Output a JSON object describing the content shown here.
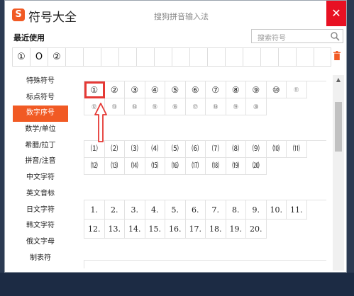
{
  "window": {
    "app_title": "符号大全",
    "logo": "S",
    "ime_name": "搜狗拼音输入法",
    "close": "✕"
  },
  "recent": {
    "label": "最近使用",
    "items": [
      "①",
      "O",
      "②",
      "",
      "",
      "",
      "",
      "",
      "",
      "",
      "",
      "",
      "",
      "",
      "",
      "",
      "",
      ""
    ]
  },
  "search": {
    "placeholder": "搜索符号"
  },
  "icons": {
    "search": "search-icon",
    "trash": "trash-icon",
    "close": "close-icon",
    "arrow": "up-arrow-annotation"
  },
  "colors": {
    "accent": "#f15a24",
    "highlight": "#e53935"
  },
  "sidebar": {
    "items": [
      "特殊符号",
      "标点符号",
      "数字序号",
      "数学/单位",
      "希腊/拉丁",
      "拼音/注音",
      "中文字符",
      "英文音标",
      "日文字符",
      "韩文字符",
      "俄文字母",
      "制表符"
    ],
    "active": "数字序号"
  },
  "circled": [
    "①",
    "②",
    "③",
    "④",
    "⑤",
    "⑥",
    "⑦",
    "⑧",
    "⑨",
    "⑩",
    "⑪",
    "⑫",
    "⑬",
    "⑭",
    "⑮",
    "⑯",
    "⑰",
    "⑱",
    "⑲",
    "⑳"
  ],
  "parenthesized": [
    "⑴",
    "⑵",
    "⑶",
    "⑷",
    "⑸",
    "⑹",
    "⑺",
    "⑻",
    "⑼",
    "⑽",
    "⑾",
    "⑿",
    "⒀",
    "⒁",
    "⒂",
    "⒃",
    "⒄",
    "⒅",
    "⒆",
    "⒇"
  ],
  "dotted": [
    "1.",
    "2.",
    "3.",
    "4.",
    "5.",
    "6.",
    "7.",
    "8.",
    "9.",
    "10.",
    "11.",
    "12.",
    "13.",
    "14.",
    "15.",
    "16.",
    "17.",
    "18.",
    "19.",
    "20."
  ]
}
